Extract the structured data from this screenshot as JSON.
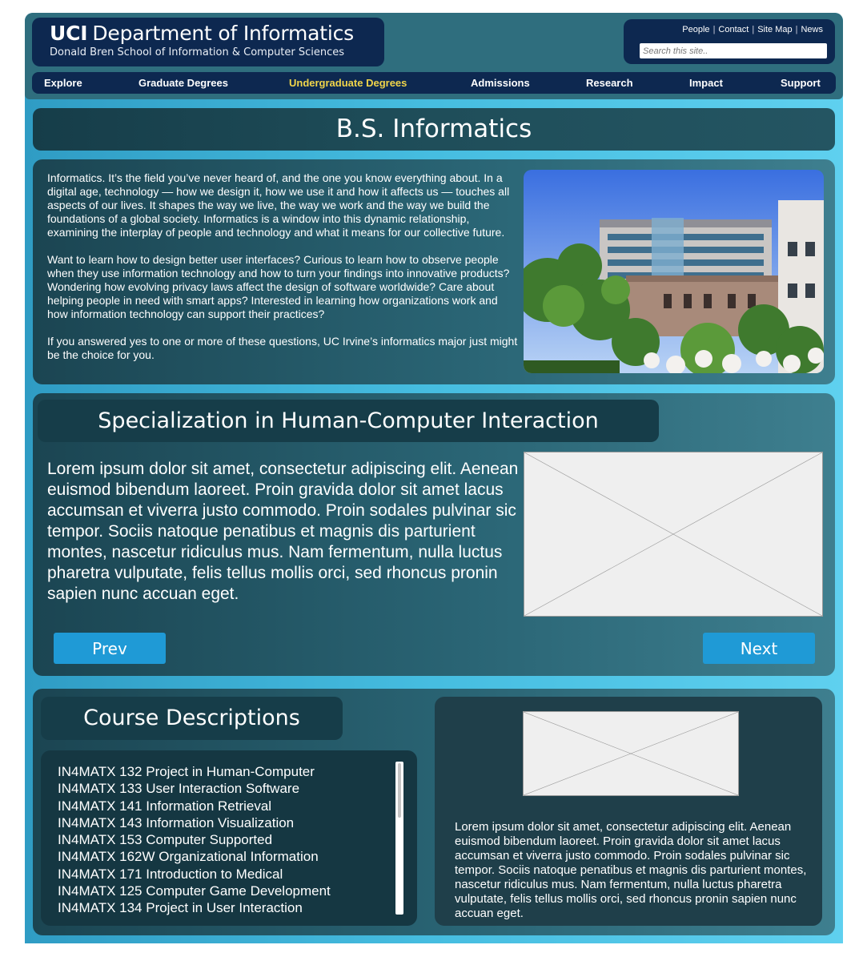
{
  "header": {
    "brand_strong": "UCI",
    "brand_title": "Department of Informatics",
    "brand_subtitle": "Donald Bren School of Information & Computer Sciences",
    "util_links": [
      "People",
      "Contact",
      "Site Map",
      "News"
    ],
    "search_placeholder": "Search this site.."
  },
  "nav": {
    "items": [
      "Explore",
      "Graduate Degrees",
      "Undergraduate Degrees",
      "Admissions",
      "Research",
      "Impact",
      "Support"
    ],
    "active": "Undergraduate Degrees",
    "active_color": "#f0d54a"
  },
  "page_title": "B.S. Informatics",
  "intro": {
    "paragraphs": [
      "Informatics. It’s the field you’ve never heard of, and the one you know everything about. In a digital age, technology — how we design it, how we use it and how it affects us — touches all aspects of our lives. It shapes the way we live, the way we work and the way we build the foundations of a global society. Informatics is a window into this dynamic relationship, examining the interplay of people and technology and what it means for our collective future.",
      "Want to learn how to design better user interfaces? Curious to learn how to observe people when they use information technology and how to turn your findings into innovative products? Wondering how evolving privacy laws affect the design of software worldwide? Care about helping people in need with smart apps? Interested in learning how organizations work and how information technology can support their practices?",
      "If you answered yes to one or more of these questions, UC Irvine’s informatics major just might be the choice for you."
    ]
  },
  "hci": {
    "title": "Specialization in Human-Computer Interaction",
    "body": "Lorem ipsum dolor sit amet, consectetur adipiscing elit. Aenean euismod bibendum laoreet. Proin gravida dolor sit amet lacus accumsan et viverra justo commodo. Proin sodales pulvinar sic tempor. Sociis natoque penatibus et magnis dis parturient montes, nascetur ridiculus mus. Nam fermentum, nulla luctus pharetra vulputate, felis tellus mollis orci, sed rhoncus pronin sapien nunc accuan eget.",
    "prev_label": "Prev",
    "next_label": "Next"
  },
  "courses": {
    "title": "Course Descriptions",
    "list": [
      "IN4MATX 132 Project in Human-Computer",
      "IN4MATX 133 User Interaction Software",
      "IN4MATX 141 Information Retrieval",
      "IN4MATX 143 Information Visualization",
      "IN4MATX 153 Computer Supported",
      "IN4MATX 162W Organizational Information",
      "IN4MATX 171 Introduction to Medical",
      "IN4MATX 125 Computer Game Development",
      "IN4MATX 134 Project in User Interaction"
    ],
    "description": "Lorem ipsum dolor sit amet, consectetur adipiscing elit. Aenean euismod bibendum laoreet. Proin gravida dolor sit amet lacus accumsan et viverra justo commodo. Proin sodales pulvinar sic tempor. Sociis natoque penatibus et magnis dis parturient montes, nascetur ridiculus mus. Nam fermentum, nulla luctus pharetra vulputate, felis tellus mollis orci, sed rhoncus pronin sapien nunc accuan eget."
  },
  "colors": {
    "header_navy": "#0d2850",
    "button_blue": "#1f9ad6",
    "frame_cyan": "#46bde0"
  }
}
